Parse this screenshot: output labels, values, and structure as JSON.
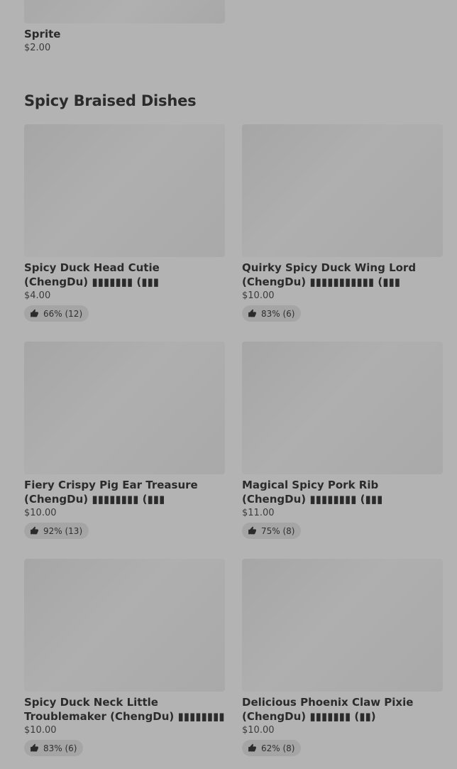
{
  "previous_item": {
    "name": "Sprite",
    "price": "$2.00"
  },
  "section": {
    "title": "Spicy Braised Dishes"
  },
  "items": [
    {
      "name": "Spicy Duck Head Cutie (ChengDu) ▮▮▮▮▮▮▮ (▮▮▮",
      "price": "$4.00",
      "rating": "66% (12)"
    },
    {
      "name": "Quirky Spicy Duck Wing Lord (ChengDu) ▮▮▮▮▮▮▮▮▮▮▮ (▮▮▮",
      "price": "$10.00",
      "rating": "83% (6)"
    },
    {
      "name": "Fiery Crispy Pig Ear Treasure (ChengDu) ▮▮▮▮▮▮▮▮ (▮▮▮",
      "price": "$10.00",
      "rating": "92% (13)"
    },
    {
      "name": "Magical Spicy Pork Rib (ChengDu) ▮▮▮▮▮▮▮▮ (▮▮▮",
      "price": "$11.00",
      "rating": "75% (8)"
    },
    {
      "name": "Spicy Duck Neck Little Troublemaker (ChengDu) ▮▮▮▮▮▮▮▮ (▮▮▮",
      "price": "$10.00",
      "rating": "83% (6)"
    },
    {
      "name": "Delicious Phoenix Claw Pixie (ChengDu) ▮▮▮▮▮▮▮ (▮▮)",
      "price": "$10.00",
      "rating": "62% (8)"
    }
  ],
  "icons": {
    "rating": "thumbs-up-icon"
  }
}
